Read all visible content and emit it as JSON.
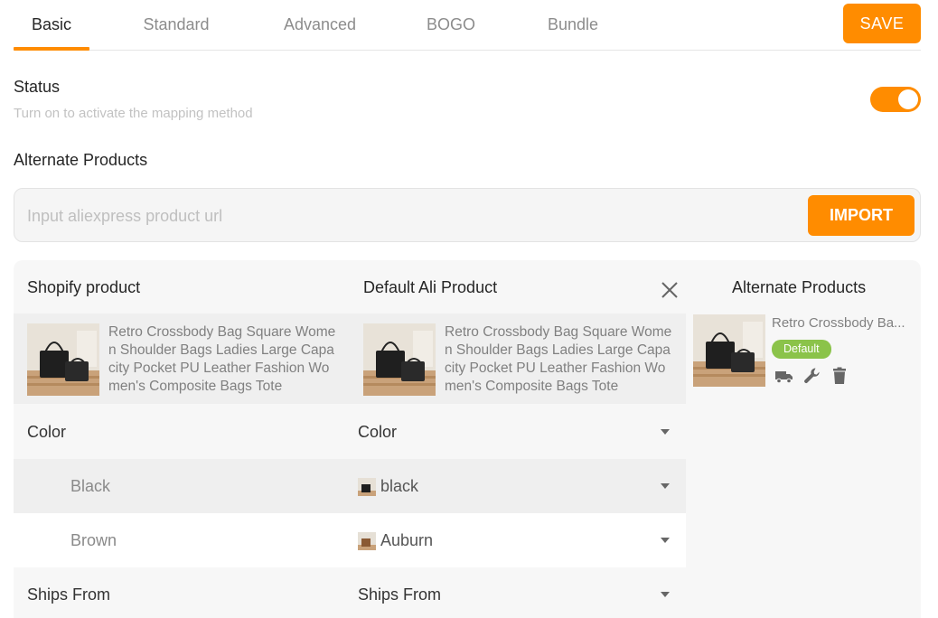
{
  "tabs": [
    {
      "label": "Basic",
      "active": true
    },
    {
      "label": "Standard",
      "active": false
    },
    {
      "label": "Advanced",
      "active": false
    },
    {
      "label": "BOGO",
      "active": false
    },
    {
      "label": "Bundle",
      "active": false
    }
  ],
  "save_label": "SAVE",
  "status": {
    "title": "Status",
    "subtitle": "Turn on to activate the mapping method",
    "enabled": true
  },
  "alternate_products_title": "Alternate Products",
  "url_input": {
    "placeholder": "Input aliexpress product url",
    "value": ""
  },
  "import_label": "IMPORT",
  "mapping": {
    "shopify_header": "Shopify product",
    "ali_header": "Default Ali Product",
    "alternate_header": "Alternate Products",
    "shopify_product_name": "Retro Crossbody Bag Square Women Shoulder Bags Ladies Large Capacity Pocket PU Leather Fashion Women's Composite Bags Tote",
    "ali_product_name": "Retro Crossbody Bag Square Women Shoulder Bags Ladies Large Capacity Pocket PU Leather Fashion Women's Composite Bags Tote",
    "alternate_product": {
      "name": "Retro Crossbody Ba...",
      "badge": "Default",
      "actions": [
        "truck-icon",
        "wrench-icon",
        "trash-icon"
      ]
    },
    "options": [
      {
        "type": "header",
        "label": "Color",
        "value": "Color"
      },
      {
        "type": "value",
        "label": "Black",
        "value": "black",
        "thumb": "black-bag-thumb"
      },
      {
        "type": "value",
        "label": "Brown",
        "value": "Auburn",
        "thumb": "auburn-bag-thumb"
      },
      {
        "type": "header",
        "label": "Ships From",
        "value": "Ships From"
      }
    ]
  },
  "colors": {
    "accent": "#ff8c00",
    "badge": "#8bc34a"
  }
}
